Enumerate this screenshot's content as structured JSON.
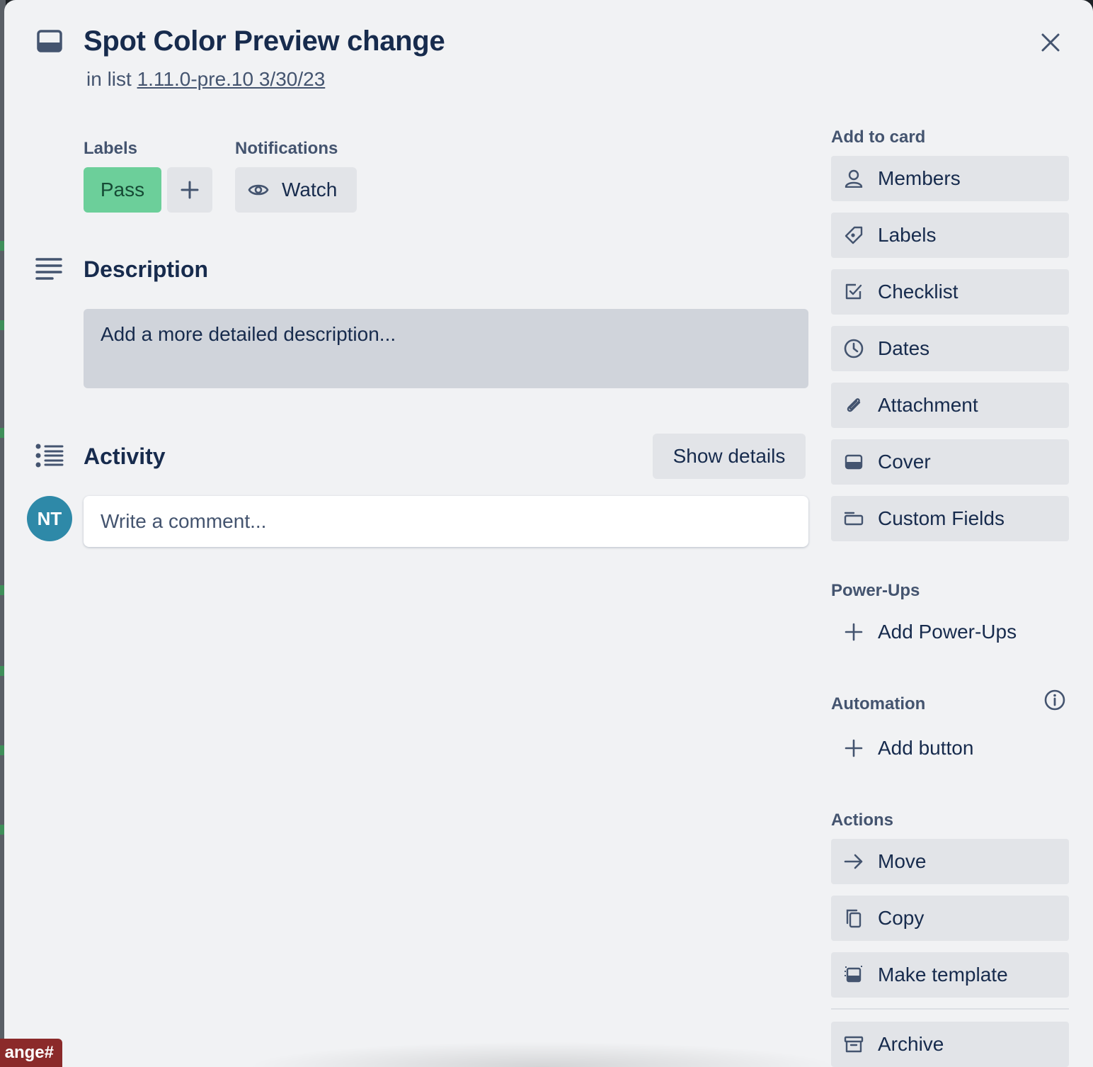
{
  "card": {
    "title": "Spot Color Preview change",
    "in_list_prefix": "in list",
    "list_name": "1.11.0-pre.10 3/30/23"
  },
  "labels": {
    "heading": "Labels",
    "items": [
      {
        "text": "Pass",
        "color": "#6ccf9a"
      }
    ],
    "add_icon": "plus-icon"
  },
  "notifications": {
    "heading": "Notifications",
    "watch_label": "Watch",
    "watch_icon": "eye-icon"
  },
  "description": {
    "heading": "Description",
    "placeholder": "Add a more detailed description..."
  },
  "activity": {
    "heading": "Activity",
    "show_details_label": "Show details",
    "avatar_initials": "NT",
    "avatar_color": "#2e89a8",
    "comment_placeholder": "Write a comment..."
  },
  "sidebar": {
    "add_to_card": {
      "heading": "Add to card",
      "items": [
        {
          "label": "Members",
          "icon": "person-icon"
        },
        {
          "label": "Labels",
          "icon": "tag-icon"
        },
        {
          "label": "Checklist",
          "icon": "checkbox-icon"
        },
        {
          "label": "Dates",
          "icon": "clock-icon"
        },
        {
          "label": "Attachment",
          "icon": "paperclip-icon"
        },
        {
          "label": "Cover",
          "icon": "cover-icon"
        },
        {
          "label": "Custom Fields",
          "icon": "custom-fields-icon"
        }
      ]
    },
    "power_ups": {
      "heading": "Power-Ups",
      "add_label": "Add Power-Ups"
    },
    "automation": {
      "heading": "Automation",
      "add_label": "Add button",
      "info_icon": "info-icon"
    },
    "actions": {
      "heading": "Actions",
      "items": [
        {
          "label": "Move",
          "icon": "arrow-right-icon"
        },
        {
          "label": "Copy",
          "icon": "copy-icon"
        },
        {
          "label": "Make template",
          "icon": "template-icon"
        },
        {
          "label": "Archive",
          "icon": "archive-icon"
        }
      ]
    }
  },
  "background_tag": {
    "text": "ange#"
  }
}
